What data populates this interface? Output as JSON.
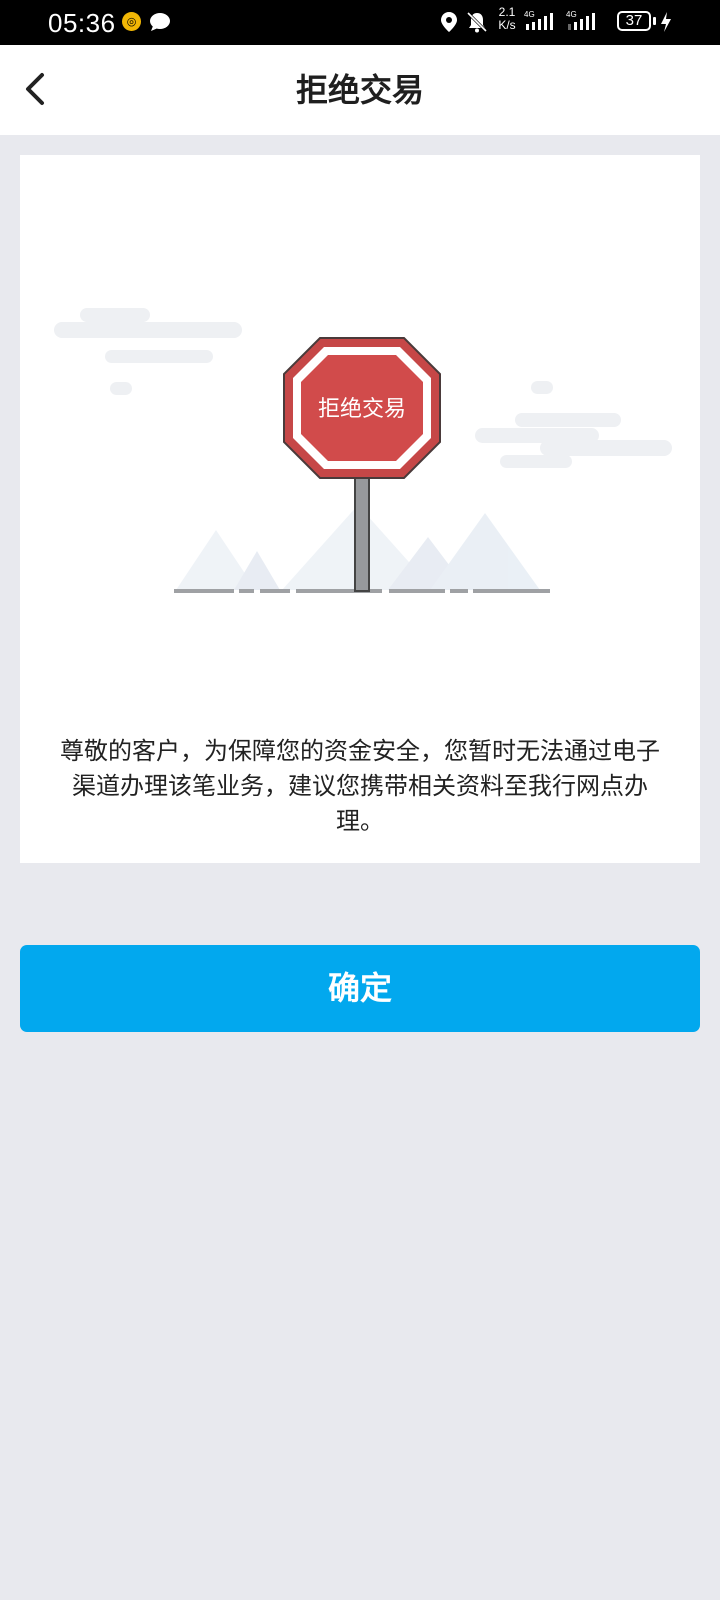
{
  "status_bar": {
    "time": "05:36",
    "notification_badge": "◎",
    "speed_value": "2.1",
    "speed_unit": "K/s",
    "sim1_tag": "4G",
    "sim2_tag": "4G",
    "battery_level": "37",
    "icons": [
      "coin-icon",
      "chat-bubble-icon",
      "location-icon",
      "bell-muted-icon",
      "signal-icon",
      "battery-icon",
      "charging-icon"
    ]
  },
  "header": {
    "title": "拒绝交易",
    "back_icon": "chevron-left-icon"
  },
  "illustration": {
    "sign_text": "拒绝交易",
    "sign_color": "#d14b4b",
    "icon": "stop-sign-icon"
  },
  "main": {
    "message": "尊敬的客户，为保障您的资金安全，您暂时无法通过电子渠道办理该笔业务，建议您携带相关资料至我行网点办理。"
  },
  "actions": {
    "confirm_label": "确定"
  },
  "colors": {
    "accent": "#02a8ee",
    "background": "#e8e9ee",
    "card": "#ffffff"
  }
}
